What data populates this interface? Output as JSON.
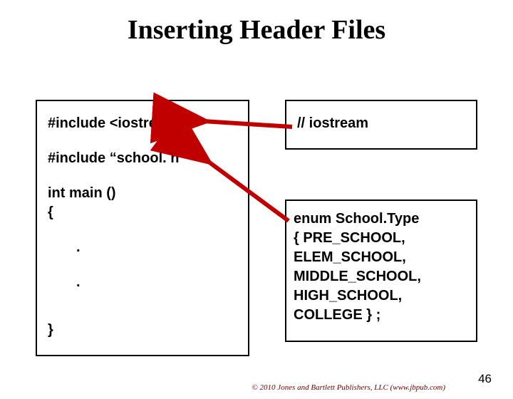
{
  "title": "Inserting Header Files",
  "left": {
    "l1": "#include  <iostream>",
    "l2": "#include  “school. h”",
    "l3": "int   main ()",
    "l4": "{",
    "l5": ".",
    "l6": ".",
    "l7": "}"
  },
  "right1": {
    "l1": "// iostream"
  },
  "right2": {
    "l1": "enum  School.Type",
    "l2": "{ PRE_SCHOOL,",
    "l3": "  ELEM_SCHOOL,",
    "l4": "  MIDDLE_SCHOOL,",
    "l5": "  HIGH_SCHOOL,",
    "l6": "  COLLEGE } ;"
  },
  "footer": "© 2010 Jones and Bartlett Publishers, LLC (www.jbpub.com)",
  "slide_num": "46"
}
